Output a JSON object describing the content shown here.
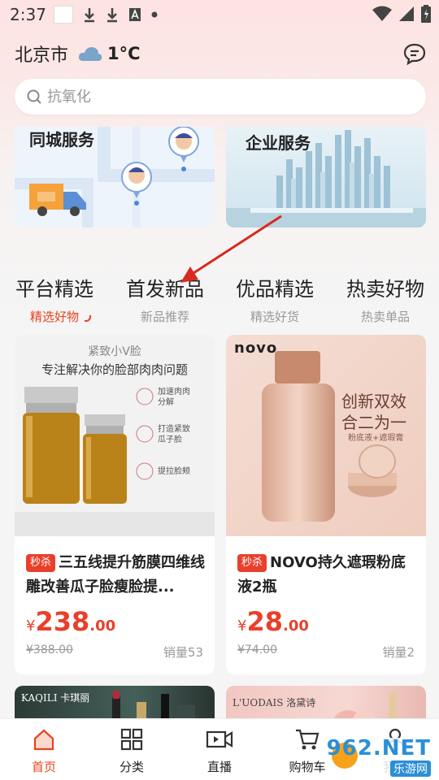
{
  "status_bar": {
    "time": "2:37"
  },
  "header": {
    "city": "北京市",
    "temperature": "1°C"
  },
  "search": {
    "placeholder": "抗氧化"
  },
  "services": {
    "left_title": "同城服务",
    "right_title": "企业服务"
  },
  "tabs": [
    {
      "title": "平台精选",
      "subtitle": "精选好物"
    },
    {
      "title": "首发新品",
      "subtitle": "新品推荐"
    },
    {
      "title": "优品精选",
      "subtitle": "精选好货"
    },
    {
      "title": "热卖好物",
      "subtitle": "热卖单品"
    }
  ],
  "products": [
    {
      "tag": "秒杀",
      "title": "三五线提升筋膜四维线雕改善瓜子脸瘦脸提...",
      "currency": "¥",
      "price_int": "238",
      "price_dec": ".00",
      "original_price": "¥388.00",
      "sales": "销量53",
      "image": {
        "heading": "紧致小V脸",
        "subheading": "专注解决你的脸部肉肉问题",
        "features": [
          "加速肉肉分解",
          "打造紧致瓜子脸",
          "提拉脸颊"
        ]
      }
    },
    {
      "tag": "秒杀",
      "title": "NOVO持久遮瑕粉底液2瓶",
      "currency": "¥",
      "price_int": "28",
      "price_dec": ".00",
      "original_price": "¥74.00",
      "sales": "销量2",
      "image": {
        "brand": "novo",
        "line1": "创新双效",
        "line2": "合二为一",
        "line3": "粉底液+遮瑕膏"
      }
    }
  ],
  "next_products": [
    {
      "brand": "KAQILI 卡琪丽"
    },
    {
      "brand": "L'UODAIS 洛黛诗"
    }
  ],
  "bottom_nav": [
    {
      "label": "首页",
      "icon": "home-icon"
    },
    {
      "label": "分类",
      "icon": "grid-icon"
    },
    {
      "label": "直播",
      "icon": "video-icon"
    },
    {
      "label": "购物车",
      "icon": "cart-icon"
    },
    {
      "label": "我的",
      "icon": "user-icon"
    }
  ],
  "watermark": {
    "text": "962.NET",
    "sub": "乐游网"
  },
  "colors": {
    "accent": "#e8441f",
    "price": "#ea3f2a"
  }
}
